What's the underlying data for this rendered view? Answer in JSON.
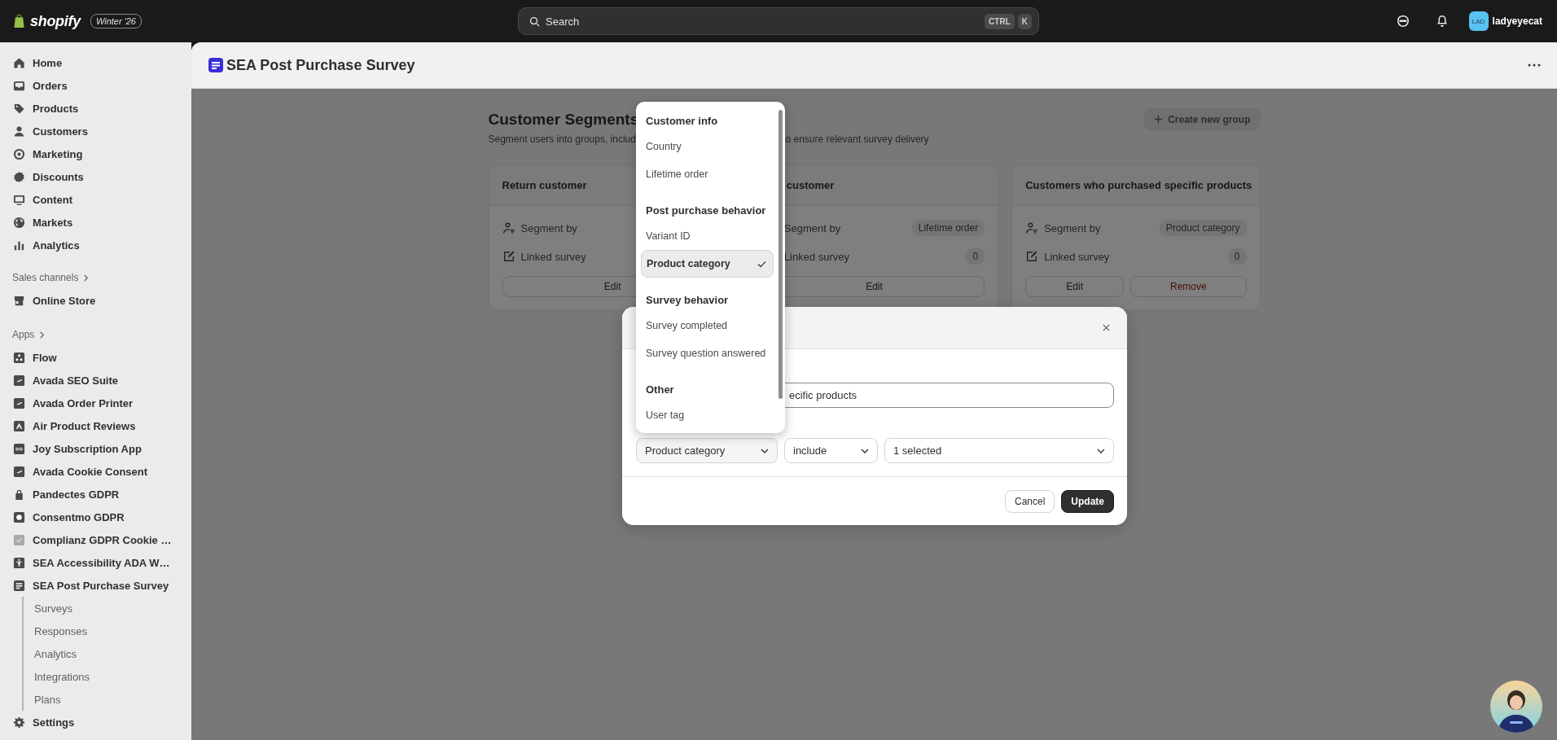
{
  "top_bar": {
    "logo_text": "shopify",
    "edition": "Winter '26",
    "search": {
      "placeholder": "Search",
      "shortcut": [
        "CTRL",
        "K"
      ]
    },
    "account": {
      "initials": "LAD",
      "name": "ladyeyecat"
    }
  },
  "sidebar": {
    "main_items": [
      {
        "label": "Home",
        "kind": "home"
      },
      {
        "label": "Orders",
        "kind": "inbox"
      },
      {
        "label": "Products",
        "kind": "tag"
      },
      {
        "label": "Customers",
        "kind": "person"
      },
      {
        "label": "Marketing",
        "kind": "target"
      },
      {
        "label": "Discounts",
        "kind": "badge"
      },
      {
        "label": "Content",
        "kind": "monitor"
      },
      {
        "label": "Markets",
        "kind": "globe"
      },
      {
        "label": "Analytics",
        "kind": "bars"
      }
    ],
    "sales_channels": {
      "heading": "Sales channels",
      "items": [
        {
          "label": "Online Store",
          "kind": "store"
        }
      ]
    },
    "apps": {
      "heading": "Apps",
      "items": [
        {
          "label": "Flow",
          "kind": "flow"
        },
        {
          "label": "Avada SEO Suite",
          "kind": "app"
        },
        {
          "label": "Avada Order Printer",
          "kind": "app"
        },
        {
          "label": "Air Product Reviews",
          "kind": "air"
        },
        {
          "label": "Joy Subscription App",
          "kind": "loop"
        },
        {
          "label": "Avada Cookie Consent",
          "kind": "app"
        },
        {
          "label": "Pandectes GDPR",
          "kind": "lock"
        },
        {
          "label": "Consentmo GDPR",
          "kind": "consent"
        },
        {
          "label": "Complianz GDPR Cookie …",
          "kind": "faded"
        },
        {
          "label": "SEA Accessibility ADA W…",
          "kind": "access"
        },
        {
          "label": "SEA Post Purchase Survey",
          "kind": "survey",
          "children": [
            {
              "label": "Surveys"
            },
            {
              "label": "Responses"
            },
            {
              "label": "Analytics"
            },
            {
              "label": "Integrations"
            },
            {
              "label": "Plans"
            }
          ]
        }
      ]
    },
    "settings": {
      "label": "Settings",
      "kind": "gear"
    }
  },
  "page_header": {
    "title": "SEA Post Purchase Survey"
  },
  "segments": {
    "title": "Customer Segments",
    "description_parts": [
      "Segment users into groups, includ",
      "o ensure relevant survey delivery"
    ],
    "create_button": {
      "label": "Create new group",
      "disabled": true
    },
    "cards": [
      {
        "title": "Return customer",
        "rows": [
          {
            "label": "Segment by",
            "kind": "segment"
          },
          {
            "label": "Linked survey",
            "kind": "survey"
          }
        ],
        "actions": [
          {
            "label": "Edit",
            "kind": "default"
          }
        ]
      },
      {
        "title": "customer",
        "rows": [
          {
            "label": "Segment by",
            "value": "Lifetime order"
          },
          {
            "label": "Linked survey",
            "value": "0"
          }
        ],
        "actions": [
          {
            "label": "Edit",
            "kind": "default"
          }
        ]
      },
      {
        "title": "Customers who purchased specific products",
        "rows": [
          {
            "label": "Segment by",
            "kind": "segment",
            "value": "Product category"
          },
          {
            "label": "Linked survey",
            "kind": "survey",
            "value": "0"
          }
        ],
        "actions": [
          {
            "label": "Edit",
            "kind": "default"
          },
          {
            "label": "Remove",
            "kind": "destructive"
          }
        ]
      }
    ]
  },
  "modal": {
    "name_field": {
      "value": "ecific products"
    },
    "condition": {
      "attribute": "Product category",
      "operator": "include",
      "value": "1 selected"
    },
    "buttons": [
      {
        "label": "Cancel",
        "kind": "secondary"
      },
      {
        "label": "Update",
        "kind": "primary"
      }
    ]
  },
  "attribute_menu": {
    "groups": [
      {
        "heading": "Customer info",
        "options": [
          {
            "label": "Country",
            "selected": false
          },
          {
            "label": "Lifetime order",
            "selected": false
          }
        ]
      },
      {
        "heading": "Post purchase behavior",
        "options": [
          {
            "label": "Variant ID",
            "selected": false
          },
          {
            "label": "Product category",
            "selected": true
          }
        ]
      },
      {
        "heading": "Survey behavior",
        "options": [
          {
            "label": "Survey completed",
            "selected": false
          },
          {
            "label": "Survey question answered",
            "selected": false
          }
        ]
      },
      {
        "heading": "Other",
        "options": [
          {
            "label": "User tag",
            "selected": false
          }
        ]
      }
    ]
  }
}
